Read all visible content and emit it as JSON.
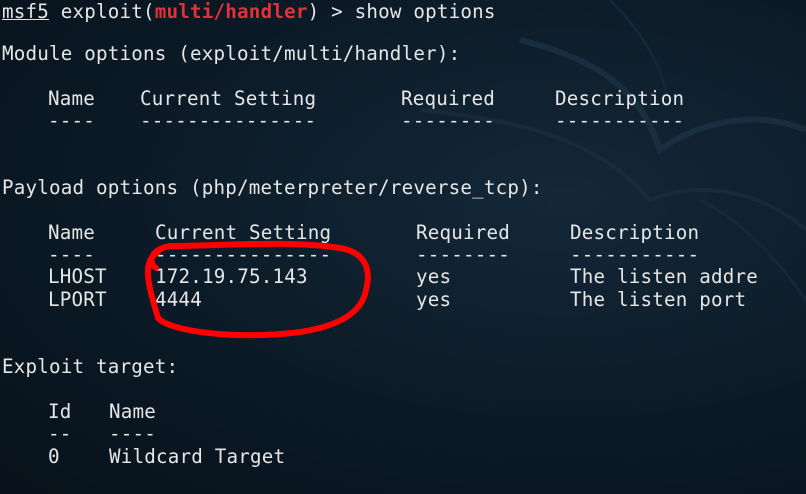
{
  "prompt": {
    "prefix": "msf5",
    "command_prefix": " exploit(",
    "module": "multi/handler",
    "command_suffix": ") > show options"
  },
  "module_options": {
    "title": "Module options (exploit/multi/handler):",
    "headers": [
      "Name",
      "Current Setting",
      "Required",
      "Description"
    ],
    "separators": [
      "----",
      "---------------",
      "--------",
      "-----------"
    ]
  },
  "payload_options": {
    "title": "Payload options (php/meterpreter/reverse_tcp):",
    "headers": [
      "Name",
      "Current Setting",
      "Required",
      "Description"
    ],
    "separators": [
      "----",
      "---------------",
      "--------",
      "-----------"
    ],
    "rows": [
      {
        "name": "LHOST",
        "setting": "172.19.75.143",
        "required": "yes",
        "description": "The listen addre"
      },
      {
        "name": "LPORT",
        "setting": "4444",
        "required": "yes",
        "description": "The listen port"
      }
    ]
  },
  "exploit_target": {
    "title": "Exploit target:",
    "headers": [
      "Id",
      "Name"
    ],
    "separators": [
      "--",
      "----"
    ],
    "rows": [
      {
        "id": "0",
        "name": "Wildcard Target"
      }
    ]
  },
  "colors": {
    "background": "#0b1a26",
    "text": "#e6e6e6",
    "highlight": "#e3313b",
    "annotation": "#ff0000"
  }
}
